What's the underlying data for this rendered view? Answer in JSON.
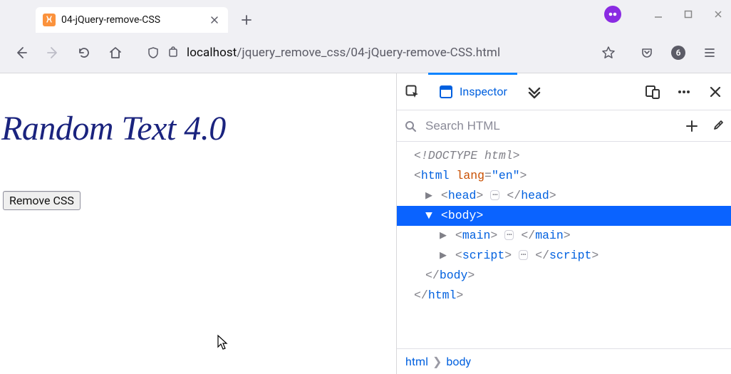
{
  "window": {
    "tab_title": "04-jQuery-remove-CSS",
    "badge_count": "6"
  },
  "urlbar": {
    "host": "localhost",
    "path": "/jquery_remove_css/04-jQuery-remove-CSS.html"
  },
  "page": {
    "heading": "Random Text 4.0",
    "button_label": "Remove CSS"
  },
  "devtools": {
    "inspector_label": "Inspector",
    "search_placeholder": "Search HTML",
    "tree": {
      "doctype": "<!DOCTYPE html>",
      "html_open_pre": "<",
      "html_tag": "html",
      "lang_attr": "lang",
      "lang_val": "\"en\"",
      "html_open_post": ">",
      "head_tag": "head",
      "body_tag": "body",
      "main_tag": "main",
      "script_tag": "script",
      "close_body": "body",
      "close_html": "html"
    },
    "breadcrumbs": {
      "root": "html",
      "current": "body"
    }
  }
}
